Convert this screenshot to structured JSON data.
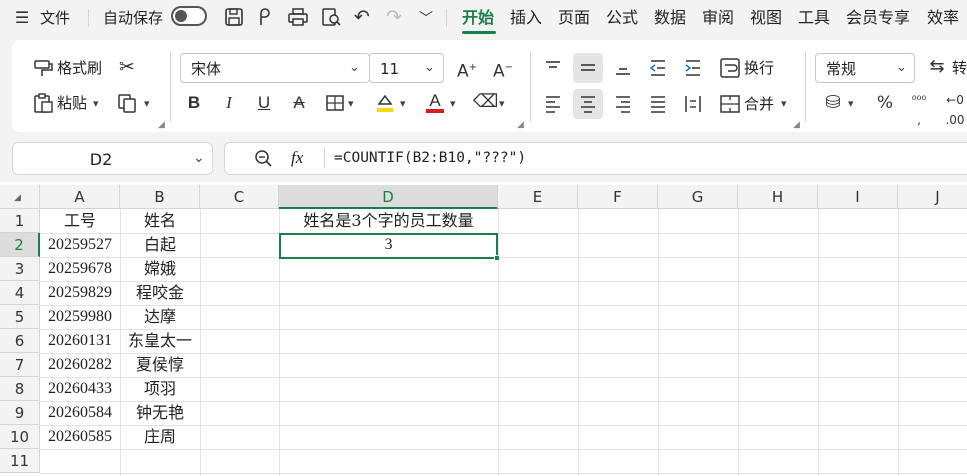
{
  "menubar": {
    "file_label": "文件",
    "autosave_label": "自动保存",
    "autosave_on": false,
    "tabs": [
      "开始",
      "插入",
      "页面",
      "公式",
      "数据",
      "审阅",
      "视图",
      "工具",
      "会员专享",
      "效率"
    ],
    "active_tab": "开始",
    "accent_color": "#1a7f4b"
  },
  "ribbon": {
    "format_painter": "格式刷",
    "paste": "粘贴",
    "font_name": "宋体",
    "font_size": "11",
    "wrap_text": "换行",
    "merge": "合并",
    "number_format": "常规",
    "convert": "转"
  },
  "formula_bar": {
    "name_box": "D2",
    "fx_label": "fx",
    "formula": "=COUNTIF(B2:B10,\"???\")"
  },
  "sheet": {
    "columns": [
      "A",
      "B",
      "C",
      "D",
      "E",
      "F",
      "G",
      "H",
      "I",
      "J"
    ],
    "selected_column": "D",
    "rows": [
      "1",
      "2",
      "3",
      "4",
      "5",
      "6",
      "7",
      "8",
      "9",
      "10",
      "11"
    ],
    "selected_row": "2",
    "cells": {
      "A1": "工号",
      "B1": "姓名",
      "D1": "姓名是3个字的员工数量",
      "A2": "20259527",
      "B2": "白起",
      "D2": "3",
      "A3": "20259678",
      "B3": "嫦娥",
      "A4": "20259829",
      "B4": "程咬金",
      "A5": "20259980",
      "B5": "达摩",
      "A6": "20260131",
      "B6": "东皇太一",
      "A7": "20260282",
      "B7": "夏侯惇",
      "A8": "20260433",
      "B8": "项羽",
      "A9": "20260584",
      "B9": "钟无艳",
      "A10": "20260585",
      "B10": "庄周"
    }
  }
}
